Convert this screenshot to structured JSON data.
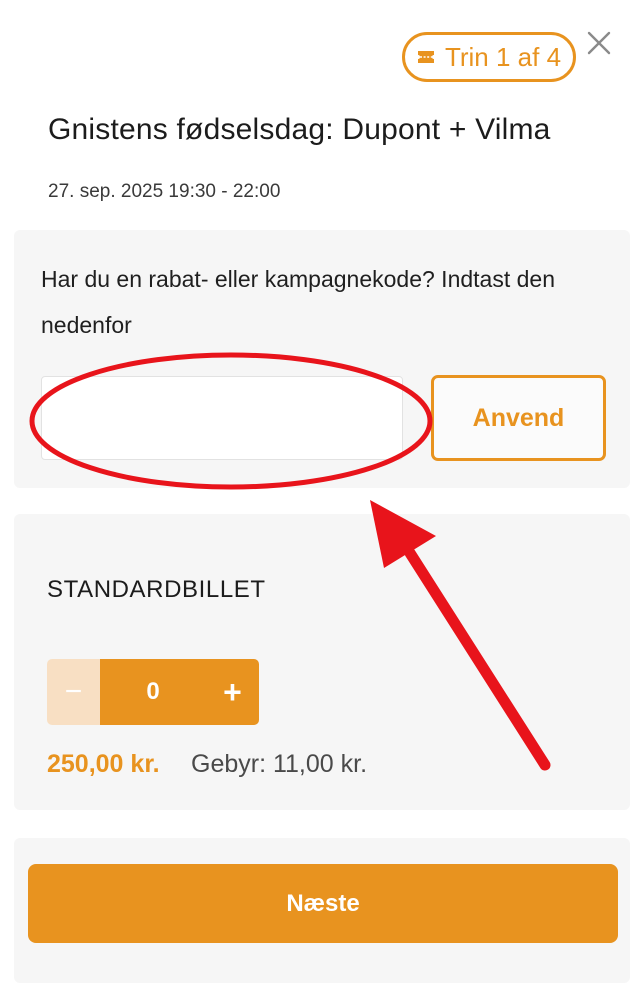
{
  "header": {
    "step_label": "Trin 1 af 4",
    "ticket_icon": "ticket-icon",
    "close_icon": "close-icon"
  },
  "event": {
    "title": "Gnistens fødselsdag: Dupont + Vilma",
    "datetime": "27. sep. 2025 19:30 - 22:00"
  },
  "promo": {
    "prompt": "Har du en rabat- eller kampagnekode? Indtast den nedenfor",
    "input_value": "",
    "apply_label": "Anvend"
  },
  "ticket": {
    "name": "STANDARDBILLET",
    "minus_label": "−",
    "quantity": "0",
    "plus_label": "+",
    "price": "250,00 kr.",
    "fee": "Gebyr: 11,00 kr."
  },
  "footer": {
    "next_label": "Næste"
  },
  "colors": {
    "accent": "#e8931f",
    "accent_light": "#f8dfc3",
    "card_bg": "#f6f6f6",
    "annotation": "#e8141b"
  }
}
